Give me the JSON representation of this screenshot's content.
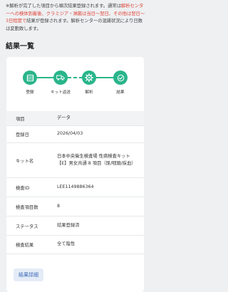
{
  "notice": {
    "part1": "※解析が完了した項目から順次結果登録されます。通常は",
    "part2_red": "解析センターへの検体到着後、クラミジア・淋菌は当日〜翌日、その他は翌日〜3日程度で",
    "part3": "結果が登録されます。解析センターの混雑状況により日数は変動致します。"
  },
  "section_title": "結果一覧",
  "steps": [
    {
      "label": "登録",
      "icon": "list-icon"
    },
    {
      "label": "キット返送",
      "icon": "truck-icon"
    },
    {
      "label": "解析",
      "icon": "gear-icon"
    },
    {
      "label": "結果",
      "icon": "check-icon"
    }
  ],
  "table": {
    "header": {
      "key": "項目",
      "value": "データ"
    },
    "rows": [
      {
        "key": "登録日",
        "value": "2026/04/03"
      },
      {
        "key": "キット名",
        "value": "日本中央衛生検査場 性病検査キット【E】男女共通 8 項目（尿/咽頭/採血）"
      },
      {
        "key": "検査ID",
        "value": "LEE1149886364"
      },
      {
        "key": "検査項目数",
        "value": "8"
      },
      {
        "key": "ステータス",
        "value": "結果登録済"
      },
      {
        "key": "検査結果",
        "value": "全て陰性"
      }
    ]
  },
  "detail_button": "結果詳細",
  "colors": {
    "accent": "#29b58a",
    "alert_red": "#e0453a",
    "button_text": "#3a66b5"
  }
}
